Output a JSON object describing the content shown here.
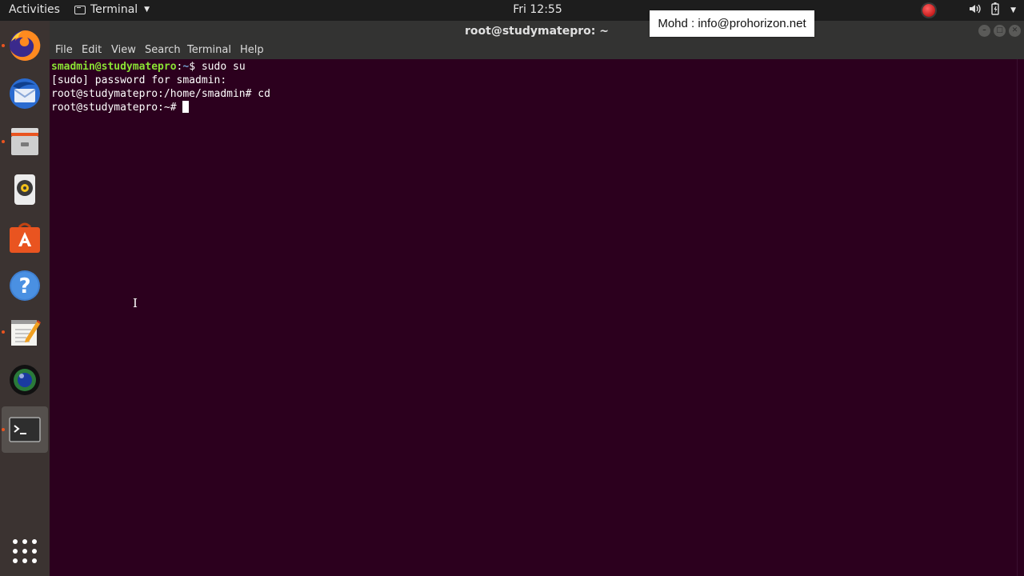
{
  "topbar": {
    "activities": "Activities",
    "app_name": "Terminal",
    "clock": "Fri 12:55"
  },
  "dock": {
    "items": [
      {
        "name": "firefox-icon"
      },
      {
        "name": "thunderbird-icon"
      },
      {
        "name": "files-icon"
      },
      {
        "name": "rhythmbox-icon"
      },
      {
        "name": "software-center-icon"
      },
      {
        "name": "help-icon"
      },
      {
        "name": "text-editor-icon"
      },
      {
        "name": "shotwell-icon"
      },
      {
        "name": "terminal-icon"
      }
    ]
  },
  "window": {
    "title": "root@studymatepro: ~",
    "menu": [
      "File",
      "Edit",
      "View",
      "Search",
      "Terminal",
      "Help"
    ]
  },
  "terminal": {
    "line1": {
      "user": "smadmin@studymatepro",
      "sep": ":",
      "path": "~",
      "prompt": "$ ",
      "cmd": "sudo su"
    },
    "line2": "[sudo] password for smadmin:",
    "line3": "root@studymatepro:/home/smadmin# cd",
    "line4": "root@studymatepro:~# "
  },
  "overlay": {
    "text": "Mohd : info@prohorizon.net"
  },
  "colors": {
    "terminal_bg": "#2c001e",
    "prompt_user": "#8ae234",
    "prompt_path": "#729fcf",
    "accent": "#e95420"
  }
}
